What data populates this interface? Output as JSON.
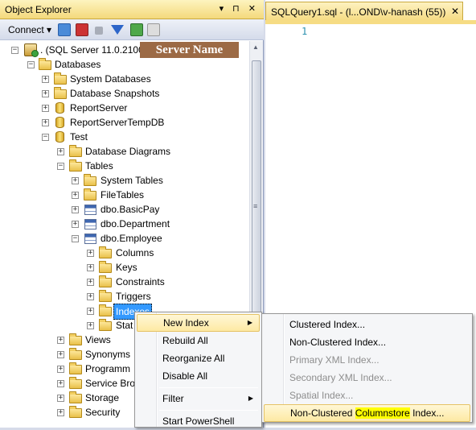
{
  "object_explorer": {
    "title": "Object Explorer",
    "title_buttons": "▾ ⊓ ✕",
    "toolbar": {
      "connect_label": "Connect ▾"
    }
  },
  "server_badge": "Server Name",
  "tree": {
    "server": ". (SQL Server 11.0.2100 -",
    "databases": "Databases",
    "system_databases": "System Databases",
    "database_snapshots": "Database Snapshots",
    "reportserver": "ReportServer",
    "reportservertempdb": "ReportServerTempDB",
    "test": "Test",
    "database_diagrams": "Database Diagrams",
    "tables": "Tables",
    "system_tables": "System Tables",
    "filetables": "FileTables",
    "dbo_basicpay": "dbo.BasicPay",
    "dbo_department": "dbo.Department",
    "dbo_employee": "dbo.Employee",
    "columns": "Columns",
    "keys": "Keys",
    "constraints": "Constraints",
    "triggers": "Triggers",
    "indexes": "Indexes",
    "statistics": "Stat",
    "views": "Views",
    "synonyms": "Synonyms",
    "programmability": "Programm",
    "service_broker": "Service Bro",
    "storage": "Storage",
    "security": "Security"
  },
  "query_window": {
    "tab_title": "SQLQuery1.sql - (l...OND\\v-hanash (55))",
    "close": "✕",
    "line_number": "1"
  },
  "context_menu": {
    "new_index": "New Index",
    "rebuild_all": "Rebuild All",
    "reorganize_all": "Reorganize All",
    "disable_all": "Disable All",
    "filter": "Filter",
    "start_powershell": "Start PowerShell"
  },
  "submenu": {
    "clustered": "Clustered Index...",
    "non_clustered": "Non-Clustered Index...",
    "primary_xml": "Primary XML Index...",
    "secondary_xml": "Secondary XML Index...",
    "spatial": "Spatial Index...",
    "ncci_prefix": "Non-Clustered ",
    "ncci_highlight": "Columnstore",
    "ncci_suffix": " Index..."
  }
}
